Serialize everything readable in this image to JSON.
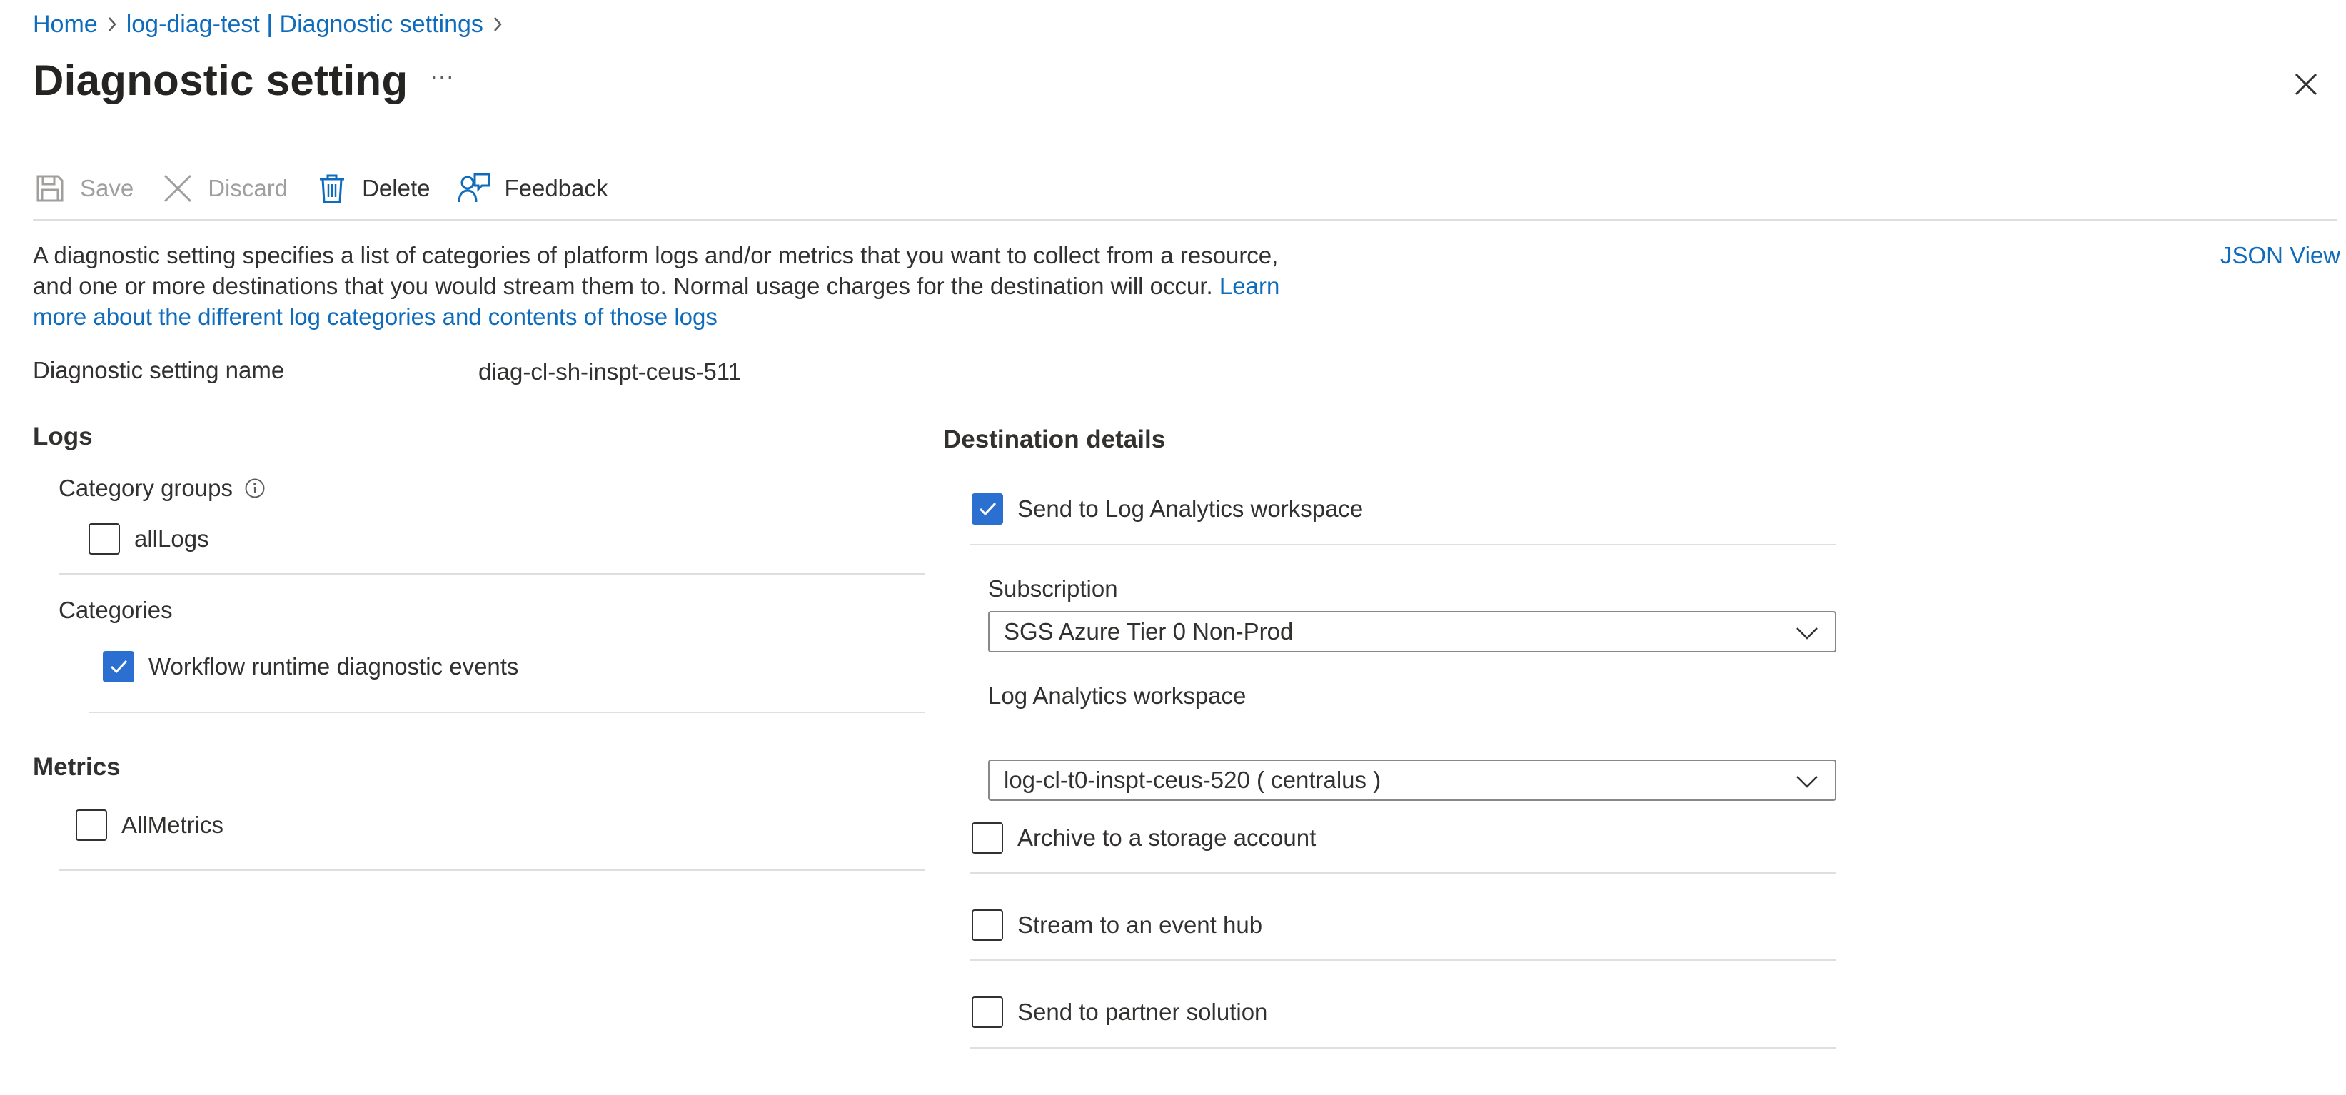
{
  "breadcrumb": {
    "items": [
      "Home",
      "log-diag-test | Diagnostic settings"
    ]
  },
  "title": "Diagnostic setting",
  "more_label": "···",
  "toolbar": {
    "save": "Save",
    "discard": "Discard",
    "delete": "Delete",
    "feedback": "Feedback"
  },
  "description": {
    "text": "A diagnostic setting specifies a list of categories of platform logs and/or metrics that you want to collect from a resource, and one or more destinations that you would stream them to. Normal usage charges for the destination will occur.",
    "link": "Learn more about the different log categories and contents of those logs"
  },
  "json_view": "JSON View",
  "setting_name": {
    "label": "Diagnostic setting name",
    "value": "diag-cl-sh-inspt-ceus-511"
  },
  "logs": {
    "heading": "Logs",
    "category_groups_label": "Category groups",
    "category_groups": [
      {
        "label": "allLogs",
        "checked": false
      }
    ],
    "categories_label": "Categories",
    "categories": [
      {
        "label": "Workflow runtime diagnostic events",
        "checked": true
      }
    ]
  },
  "metrics": {
    "heading": "Metrics",
    "items": [
      {
        "label": "AllMetrics",
        "checked": false
      }
    ]
  },
  "destination": {
    "heading": "Destination details",
    "log_analytics": {
      "label": "Send to Log Analytics workspace",
      "checked": true
    },
    "subscription": {
      "label": "Subscription",
      "value": "SGS Azure Tier 0 Non-Prod"
    },
    "workspace": {
      "label": "Log Analytics workspace",
      "value": "log-cl-t0-inspt-ceus-520 ( centralus )"
    },
    "archive": {
      "label": "Archive to a storage account",
      "checked": false
    },
    "event_hub": {
      "label": "Stream to an event hub",
      "checked": false
    },
    "partner": {
      "label": "Send to partner solution",
      "checked": false
    }
  },
  "colors": {
    "accent": "#2b6fd0",
    "link": "#0f6cbd",
    "text": "#323130",
    "disabled": "#a19f9d",
    "divider": "#e1dfdd"
  }
}
